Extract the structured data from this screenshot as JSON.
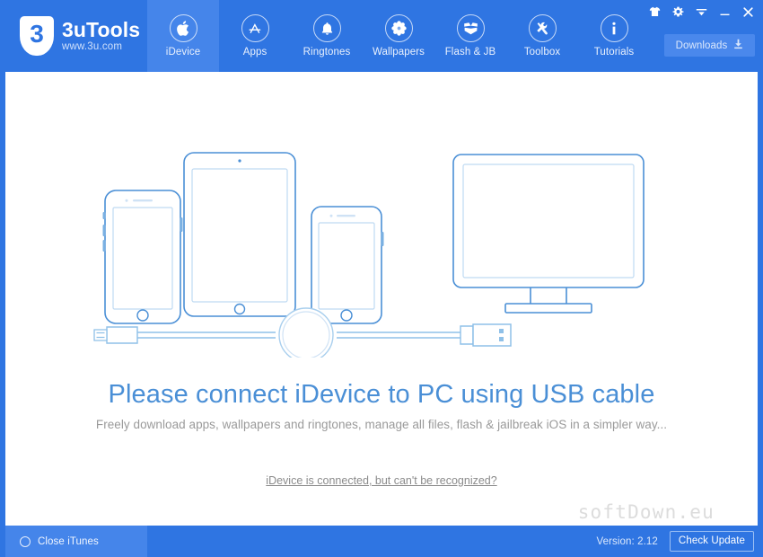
{
  "app": {
    "brand_name": "3uTools",
    "brand_url": "www.3u.com",
    "logo_glyph": "3",
    "header_color": "#2f75e2",
    "active_tab_color": "#4585ea",
    "accent_text_color": "#4a8fd6"
  },
  "nav": {
    "items": [
      {
        "label": "iDevice",
        "icon": "apple-icon",
        "active": true
      },
      {
        "label": "Apps",
        "icon": "appstore-icon",
        "active": false
      },
      {
        "label": "Ringtones",
        "icon": "bell-icon",
        "active": false
      },
      {
        "label": "Wallpapers",
        "icon": "flower-icon",
        "active": false
      },
      {
        "label": "Flash & JB",
        "icon": "open-box-icon",
        "active": false
      },
      {
        "label": "Toolbox",
        "icon": "tools-icon",
        "active": false
      },
      {
        "label": "Tutorials",
        "icon": "info-icon",
        "active": false
      }
    ]
  },
  "window_controls": {
    "items": [
      {
        "name": "skin-icon",
        "title": "Skin"
      },
      {
        "name": "settings-icon",
        "title": "Settings"
      },
      {
        "name": "menu-icon",
        "title": "Menu"
      },
      {
        "name": "minimize-icon",
        "title": "Minimize"
      },
      {
        "name": "close-icon",
        "title": "Close"
      }
    ]
  },
  "downloads": {
    "label": "Downloads",
    "icon": "download-arrow-icon"
  },
  "main": {
    "headline": "Please connect iDevice to PC using USB cable",
    "subline": "Freely download apps, wallpapers and ringtones, manage all files, flash & jailbreak iOS in a simpler way...",
    "help_link": "iDevice is connected, but can't be recognized?",
    "watermark": "softDown.eu",
    "illustration": {
      "name": "devices-and-monitor-illustration",
      "parts": [
        "ipad",
        "iphone-left",
        "iphone-right",
        "monitor",
        "usb-cable"
      ],
      "stroke_color": "#4a8fd6"
    }
  },
  "footer": {
    "close_itunes_label": "Close iTunes",
    "version_label": "Version: 2.12",
    "check_update_label": "Check Update"
  }
}
